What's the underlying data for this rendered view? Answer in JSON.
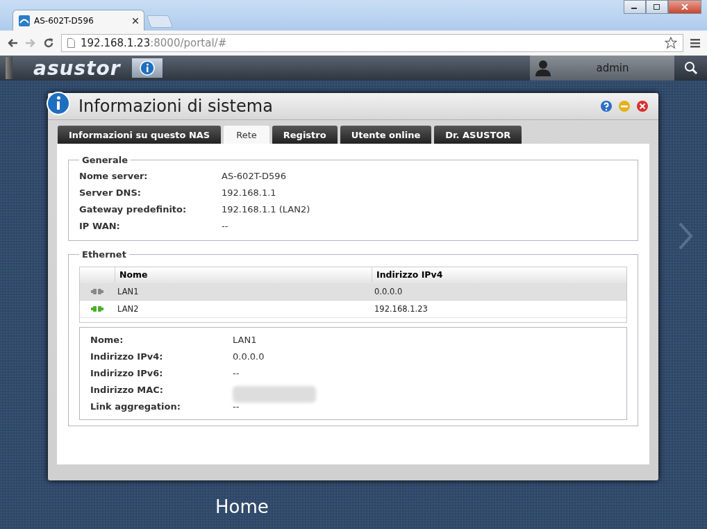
{
  "browser": {
    "tab_title": "AS-602T-D596",
    "url_host": "192.168.1.23",
    "url_path": ":8000/portal/#"
  },
  "app_bar": {
    "logo": "asustor",
    "user": "admin"
  },
  "window": {
    "title": "Informazioni di sistema"
  },
  "tabs": [
    {
      "label": "Informazioni su questo NAS",
      "selected": false
    },
    {
      "label": "Rete",
      "selected": true
    },
    {
      "label": "Registro",
      "selected": false
    },
    {
      "label": "Utente online",
      "selected": false
    },
    {
      "label": "Dr. ASUSTOR",
      "selected": false
    }
  ],
  "general": {
    "legend": "Generale",
    "rows": [
      {
        "label": "Nome server:",
        "value": "AS-602T-D596"
      },
      {
        "label": "Server DNS:",
        "value": "192.168.1.1"
      },
      {
        "label": "Gateway predefinito:",
        "value": "192.168.1.1 (LAN2)"
      },
      {
        "label": "IP WAN:",
        "value": "--"
      }
    ]
  },
  "ethernet": {
    "legend": "Ethernet",
    "table": {
      "columns": [
        "Nome",
        "Indirizzo IPv4"
      ],
      "rows": [
        {
          "name": "LAN1",
          "ipv4": "0.0.0.0",
          "connected": false,
          "selected": true
        },
        {
          "name": "LAN2",
          "ipv4": "192.168.1.23",
          "connected": true,
          "selected": false
        }
      ]
    },
    "details": [
      {
        "label": "Nome:",
        "value": "LAN1",
        "kind": "text"
      },
      {
        "label": "Indirizzo IPv4:",
        "value": "0.0.0.0",
        "kind": "text"
      },
      {
        "label": "Indirizzo IPv6:",
        "value": "--",
        "kind": "text"
      },
      {
        "label": "Indirizzo MAC:",
        "kind": "blurred"
      },
      {
        "label": "Link aggregation:",
        "value": "--",
        "kind": "text"
      }
    ]
  },
  "desktop": {
    "label": "Home"
  }
}
